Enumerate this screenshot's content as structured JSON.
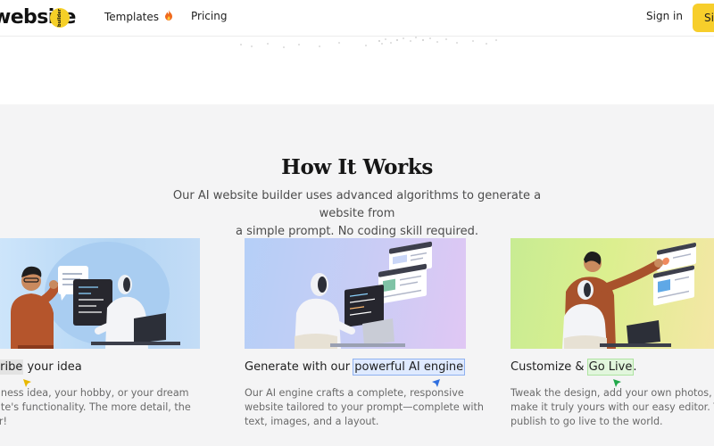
{
  "header": {
    "logo_text": "website",
    "logo_badge": "builder",
    "nav": [
      {
        "label": "Templates",
        "icon": "fire-icon"
      },
      {
        "label": "Pricing"
      }
    ],
    "signin_label": "Sign in",
    "signup_label": "Si"
  },
  "how_it_works": {
    "title": "How It Works",
    "subtitle_lines": [
      "Our AI website builder uses advanced algorithms to generate a website from",
      "a simple prompt. No coding skill required."
    ],
    "cards": [
      {
        "title_parts": [
          "cribe",
          " your idea"
        ],
        "cursor_color": "#e8b800",
        "desc_lines": [
          "siness idea, your hobby, or your dream",
          "site's functionality. The more detail, the",
          "er!"
        ]
      },
      {
        "title_parts": [
          "Generate with our ",
          "powerful AI engine"
        ],
        "cursor_color": "#2f6fdf",
        "desc_lines": [
          "Our AI engine crafts a complete, responsive",
          "website tailored to your prompt—complete with",
          "text, images, and a layout."
        ]
      },
      {
        "title_parts": [
          "Customize & ",
          "Go Live",
          "."
        ],
        "cursor_color": "#22a84a",
        "desc_lines": [
          "Tweak the design, add your own photos, and",
          "make it truly yours with our easy editor. Then",
          "publish to go live to the world."
        ]
      }
    ]
  },
  "colors": {
    "accent_yellow": "#f7ce2b",
    "section_bg": "#f4f4f5"
  }
}
